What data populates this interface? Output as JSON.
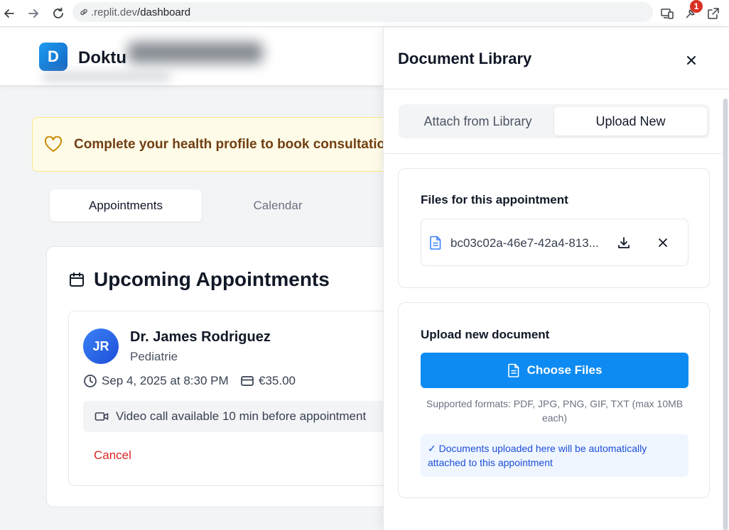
{
  "browser": {
    "url_prefix": ".replit.dev",
    "url_path": "/dashboard",
    "notification_count": "1"
  },
  "app": {
    "logo_letter": "D",
    "brand": "Doktu",
    "banner_text": "Complete your health profile to book consultatio",
    "tabs": [
      {
        "label": "Appointments",
        "active": true
      },
      {
        "label": "Calendar",
        "active": false
      }
    ],
    "upcoming": {
      "title": "Upcoming Appointments",
      "appointment": {
        "initials": "JR",
        "doctor": "Dr. James Rodriguez",
        "specialty": "Pediatrie",
        "datetime": "Sep 4, 2025 at 8:30 PM",
        "price": "€35.00",
        "video_note": "Video call available 10 min before appointment",
        "cancel_label": "Cancel"
      }
    }
  },
  "panel": {
    "title": "Document Library",
    "tabs": [
      {
        "label": "Attach from Library",
        "active": false
      },
      {
        "label": "Upload New",
        "active": true
      }
    ],
    "files_section": {
      "title": "Files for this appointment",
      "files": [
        {
          "name": "bc03c02a-46e7-42a4-813..."
        }
      ]
    },
    "upload_section": {
      "title": "Upload new document",
      "button_label": "Choose Files",
      "formats": "Supported formats: PDF, JPG, PNG, GIF, TXT (max 10MB each)",
      "info": "✓ Documents uploaded here will be automatically attached to this appointment"
    }
  },
  "colors": {
    "primary": "#0d8bf2",
    "danger": "#dc2626",
    "banner_bg": "#fefce8",
    "banner_text": "#713f12",
    "info_bg": "#eff6ff",
    "info_text": "#1d4ed8"
  },
  "icons": [
    "back-arrow-icon",
    "forward-arrow-icon",
    "reload-icon",
    "link-icon",
    "devices-icon",
    "extension-icon",
    "open-external-icon",
    "heart-icon",
    "calendar-icon",
    "clock-icon",
    "credit-card-icon",
    "video-icon",
    "close-icon",
    "file-icon",
    "download-icon",
    "remove-icon"
  ]
}
